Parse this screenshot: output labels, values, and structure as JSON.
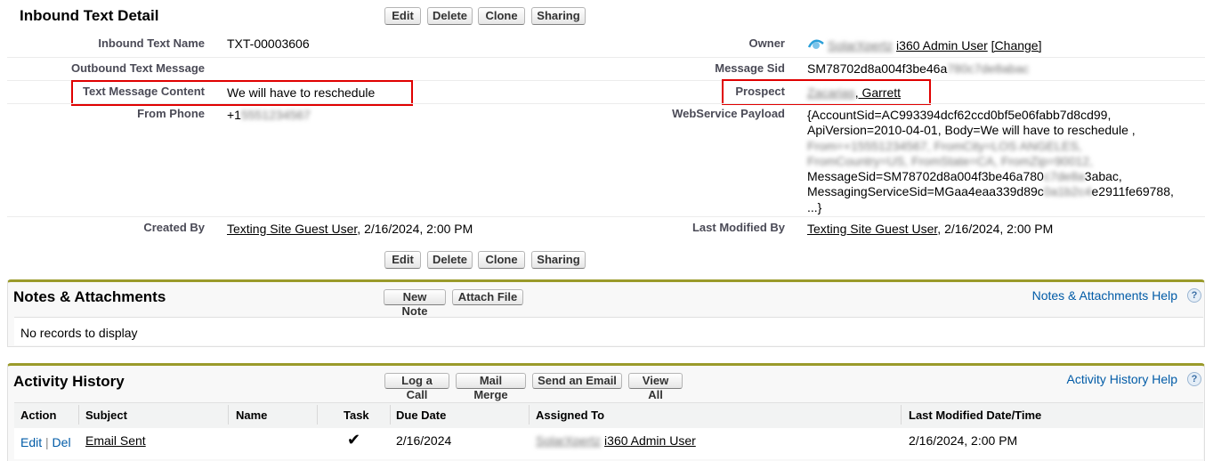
{
  "detail": {
    "title": "Inbound Text Detail",
    "buttons": {
      "edit": "Edit",
      "delete": "Delete",
      "clone": "Clone",
      "sharing": "Sharing"
    },
    "fields": {
      "inbound_text_name_label": "Inbound Text Name",
      "inbound_text_name_value": "TXT-00003606",
      "owner_label": "Owner",
      "owner_blurred": "SolarXpertz",
      "owner_value": "i360 Admin User",
      "owner_change": "[Change]",
      "outbound_label": "Outbound Text Message",
      "message_sid_label": "Message Sid",
      "message_sid_value": "SM78702d8a004f3be46a",
      "message_sid_blurred": "780c7de8abac",
      "content_label": "Text Message Content",
      "content_value": "We will have to reschedule",
      "prospect_label": "Prospect",
      "prospect_blurred": "Zacarias",
      "prospect_value": ", Garrett",
      "from_phone_label": "From Phone",
      "from_phone_prefix": "+1",
      "from_phone_blurred": "5551234567",
      "payload_label": "WebService Payload",
      "payload_line1": "{AccountSid=AC993394dcf62ccd0bf5e06fabb7d8cd99,",
      "payload_line2": "ApiVersion=2010-04-01, Body=We will have to reschedule ,",
      "payload_line3_blurred": "From=+15551234567, FromCity=LOS ANGELES,",
      "payload_line4_blurred": "FromCountry=US, FromState=CA, FromZip=90012,",
      "payload_line5_a": "MessageSid=SM78702d8a004f3be46a780",
      "payload_line5_blur": "c7de8a",
      "payload_line5_b": "3abac,",
      "payload_line6_a": "MessagingServiceSid=MGaa4eaa339d89c",
      "payload_line6_blur": "0a1b2c4",
      "payload_line6_b": "e2911fe69788,",
      "payload_line7": "...}",
      "created_by_label": "Created By",
      "created_by_user": "Texting Site Guest User",
      "created_by_date": ", 2/16/2024, 2:00 PM",
      "last_modified_label": "Last Modified By",
      "last_modified_user": "Texting Site Guest User",
      "last_modified_date": ", 2/16/2024, 2:00 PM"
    }
  },
  "notes": {
    "title": "Notes & Attachments",
    "new_note": "New Note",
    "attach_file": "Attach File",
    "help": "Notes & Attachments Help",
    "empty": "No records to display"
  },
  "activity": {
    "title": "Activity History",
    "buttons": {
      "log_call": "Log a Call",
      "mail_merge": "Mail Merge",
      "send_email": "Send an Email",
      "view_all": "View All"
    },
    "help": "Activity History Help",
    "columns": [
      "Action",
      "Subject",
      "Name",
      "Task",
      "Due Date",
      "Assigned To",
      "Last Modified Date/Time"
    ],
    "row": {
      "edit": "Edit",
      "sep": "|",
      "del": "Del",
      "subject": "Email Sent",
      "task_check": "✔",
      "due_date": "2/16/2024",
      "assigned_blurred": "SolarXpertz",
      "assigned_to": "i360 Admin User",
      "last_modified": "2/16/2024, 2:00 PM"
    }
  },
  "help_icon": "?",
  "colors": {
    "section_border": "#9a9a2a",
    "highlight": "#e00000",
    "link_blue": "#015ba7"
  }
}
